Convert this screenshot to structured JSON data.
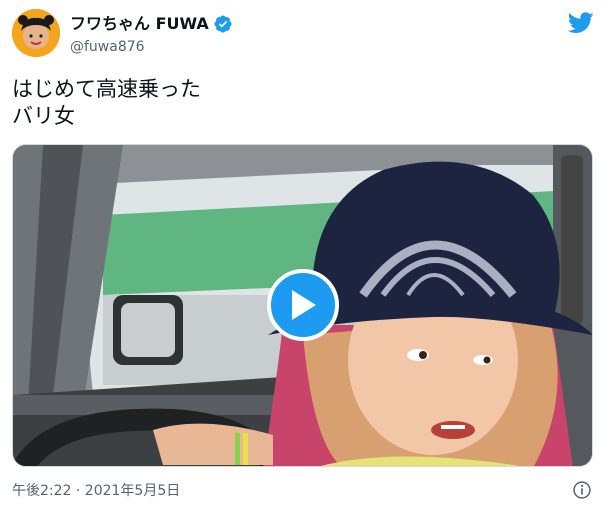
{
  "user": {
    "display_name": "フワちゃん FUWA",
    "handle": "@fuwa876",
    "verified": true,
    "avatar_icon": "user-avatar-icon"
  },
  "tweet": {
    "text": "はじめて高速乗った\nバリ女",
    "timestamp": "午後2:22 · 2021年5月5日"
  },
  "media": {
    "type": "video",
    "play_icon": "play-icon"
  },
  "icons": {
    "brand": "twitter-bird-icon",
    "verified": "verified-badge-icon",
    "info": "info-icon"
  },
  "colors": {
    "accent": "#1d9bf0",
    "secondary_text": "#536471",
    "primary_text": "#0f1419"
  }
}
